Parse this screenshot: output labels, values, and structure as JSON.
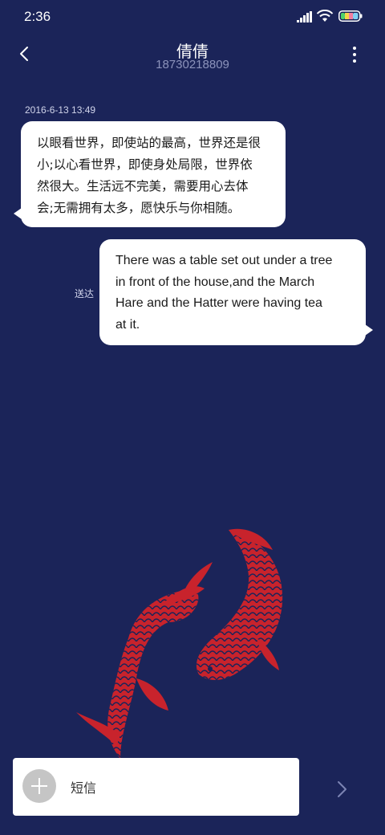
{
  "status_bar": {
    "time": "2:36",
    "icons": [
      "signal-icon",
      "wifi-icon",
      "battery-icon"
    ]
  },
  "header": {
    "contact_name": "倩倩",
    "contact_number": "18730218809",
    "back_icon": "chevron-left-icon",
    "more_icon": "more-vertical-icon"
  },
  "messages": [
    {
      "direction": "incoming",
      "timestamp": "2016-6-13 13:49",
      "lines": [
        "以眼看世界，即使站的最高，世界还是很",
        "小;以心看世界，即使身处局限，世界依",
        "然很大。生活远不完美，需要用心去体",
        "会;无需拥有太多，愿快乐与你相随。"
      ]
    },
    {
      "direction": "outgoing",
      "status": "送达",
      "lines": [
        "There was a table set out under a tree",
        "in front of the house,and the March",
        "Hare and the Hatter were having tea",
        "at it."
      ]
    }
  ],
  "composer": {
    "placeholder": "短信",
    "attach_icon": "plus-icon",
    "send_icon": "chevron-right-icon"
  },
  "colors": {
    "background": "#1b2459",
    "bubble": "#ffffff",
    "koi": "#c8232c",
    "secondary_text": "#8c93bb"
  }
}
